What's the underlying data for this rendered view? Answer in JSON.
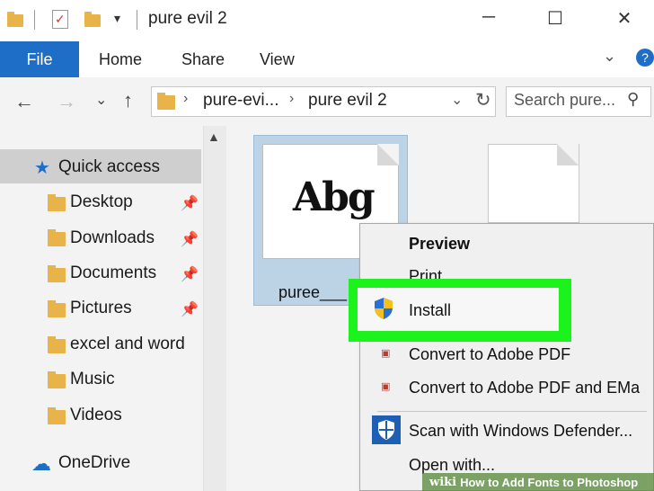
{
  "window": {
    "title": "pure evil 2",
    "controls": {
      "minimize": "─",
      "maximize": "☐",
      "close": "✕"
    }
  },
  "ribbon": {
    "tabs": [
      "File",
      "Home",
      "Share",
      "View"
    ],
    "accent": "#1e6ec8"
  },
  "address": {
    "crumbs": [
      "pure-evi...",
      "pure evil 2"
    ],
    "search_placeholder": "Search pure..."
  },
  "nav": {
    "quick_access": "Quick access",
    "items": [
      {
        "label": "Desktop",
        "pinned": true
      },
      {
        "label": "Downloads",
        "pinned": true
      },
      {
        "label": "Documents",
        "pinned": true
      },
      {
        "label": "Pictures",
        "pinned": true
      },
      {
        "label": "excel and word",
        "pinned": false
      },
      {
        "label": "Music",
        "pinned": false
      },
      {
        "label": "Videos",
        "pinned": false
      }
    ],
    "onedrive": "OneDrive"
  },
  "files": {
    "selected_name": "puree___",
    "font_preview": "Abg"
  },
  "context_menu": {
    "items": [
      "Preview",
      "Print",
      "Install",
      "Convert to Adobe PDF",
      "Convert to Adobe PDF and EMa",
      "Scan with Windows Defender...",
      "Open with..."
    ],
    "highlight_color": "#1cf21c"
  },
  "watermark": {
    "brand": "wiki",
    "text": "How to Add Fonts to Photoshop"
  }
}
